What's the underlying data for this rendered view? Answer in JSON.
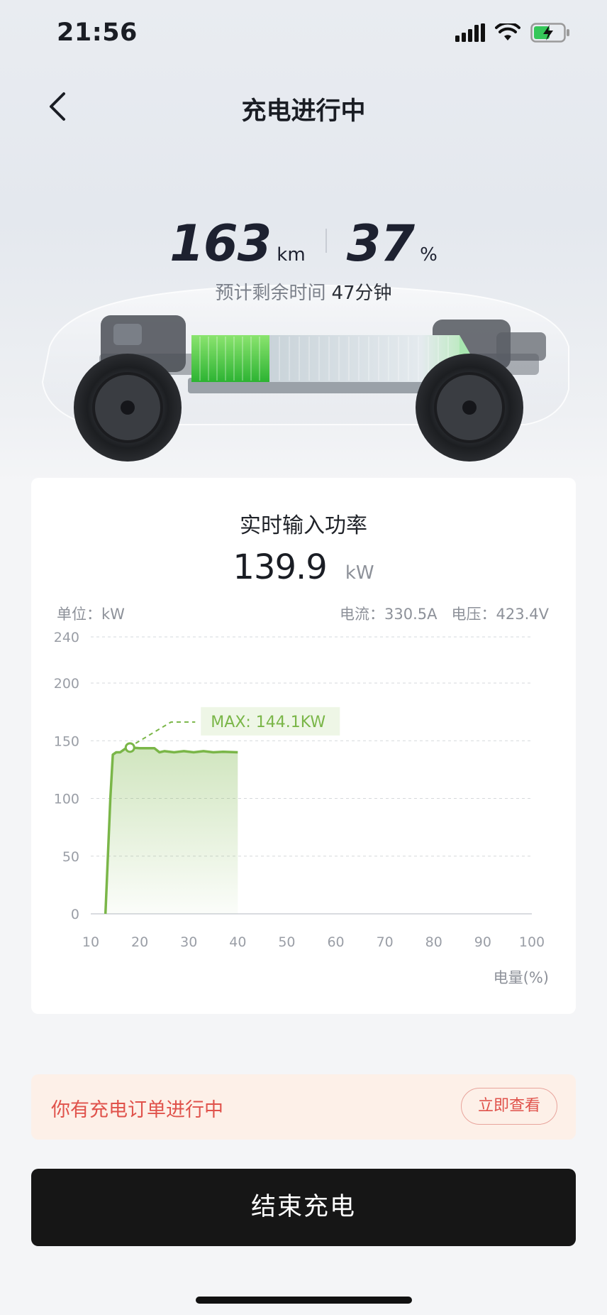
{
  "status_bar": {
    "time": "21:56"
  },
  "nav": {
    "title": "充电进行中"
  },
  "hero": {
    "range_value": "163",
    "range_unit": "km",
    "soc_value": "37",
    "soc_unit": "%",
    "eta_label": "预计剩余时间",
    "eta_value": "47分钟"
  },
  "power_card": {
    "title": "实时输入功率",
    "power_value": "139.9",
    "power_unit": "kW",
    "unit_label": "单位：kW",
    "current_label": "电流：330.5A",
    "voltage_label": "电压：423.4V",
    "x_axis_label": "电量(%)",
    "max_label": "MAX: 144.1KW"
  },
  "chart_data": {
    "type": "area",
    "xlabel": "电量(%)",
    "ylabel": "单位：kW",
    "xlim": [
      10,
      100
    ],
    "ylim": [
      0,
      240
    ],
    "x_ticks": [
      10,
      20,
      30,
      40,
      50,
      60,
      70,
      80,
      90,
      100
    ],
    "y_ticks": [
      0,
      50,
      100,
      150,
      200,
      240
    ],
    "grid": true,
    "color": "#7ab648",
    "series": [
      {
        "x": [
          13,
          14,
          14.5,
          15.2,
          16,
          17,
          18,
          20,
          23,
          24,
          25,
          27,
          29,
          31,
          33,
          35,
          37,
          40
        ],
        "y": [
          0,
          100,
          138,
          140,
          140,
          143,
          144.1,
          143.5,
          143.5,
          140,
          141,
          140,
          141,
          140,
          141,
          140,
          140.5,
          140
        ]
      }
    ],
    "max_point": {
      "x": 18,
      "y": 144.1
    },
    "annotations": [
      "MAX: 144.1KW"
    ]
  },
  "order_banner": {
    "text": "你有充电订单进行中",
    "button": "立即查看"
  },
  "end_button": {
    "label": "结束充电"
  },
  "colors": {
    "accent_green": "#7ab648",
    "alert_red": "#e0524b",
    "banner_bg": "#fdf0e8",
    "button_dark": "#161616"
  }
}
